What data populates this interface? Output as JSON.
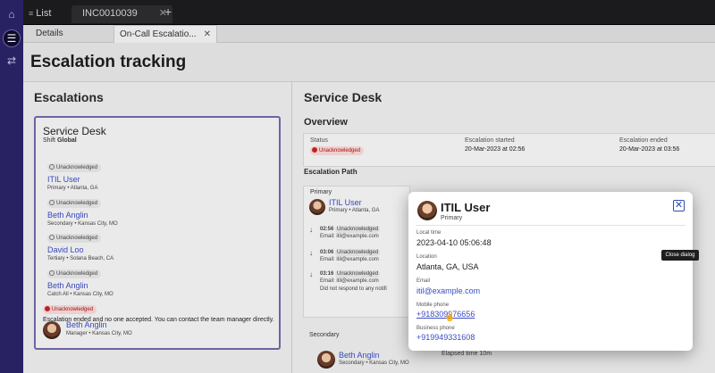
{
  "topbar": {
    "list_tab": "List",
    "incident_tab": "INC0010039"
  },
  "subtabs": {
    "details": "Details",
    "on_call": "On-Call Escalatio..."
  },
  "page": {
    "title": "Escalation tracking"
  },
  "escalations": {
    "heading": "Escalations",
    "card": {
      "title": "Service Desk",
      "shift_label": "Shift",
      "shift_value": "Global",
      "entries": [
        {
          "status": "Unacknowledged",
          "name": "ITIL User",
          "role": "Primary",
          "location": "Atlanta, GA"
        },
        {
          "status": "Unacknowledged",
          "name": "Beth Anglin",
          "role": "Secondary",
          "location": "Kansas City, MO"
        },
        {
          "status": "Unacknowledged",
          "name": "David Loo",
          "role": "Tertiary",
          "location": "Solana Beach, CA"
        },
        {
          "status": "Unacknowledged",
          "name": "Beth Anglin",
          "role": "Catch All",
          "location": "Kansas City, MO"
        }
      ],
      "final_status": "Unacknowledged",
      "ended_message": "Escalation ended and no one accepted. You can contact the team manager directly.",
      "manager": {
        "name": "Beth Anglin",
        "role": "Manager",
        "location": "Kansas City, MO"
      }
    }
  },
  "service_desk": {
    "heading": "Service Desk",
    "overview_heading": "Overview",
    "overview": {
      "status_label": "Status",
      "status_value": "Unacknowledged",
      "started_label": "Escalation started",
      "started_value": "20-Mar-2023 at 02:56",
      "ended_label": "Escalation ended",
      "ended_value": "20-Mar-2023 at 03:56"
    },
    "path_heading": "Escalation Path",
    "primary_label": "Primary",
    "primary_user": {
      "name": "ITIL User",
      "role": "Primary",
      "location": "Atlanta, GA"
    },
    "attempts": [
      {
        "time": "02:56",
        "status": "Unacknowledged",
        "detail": "Email: itil@example.com"
      },
      {
        "time": "03:06",
        "status": "Unacknowledged",
        "detail": "Email: itil@example.com"
      },
      {
        "time": "03:16",
        "status": "Unacknowledged",
        "detail": "Email: itil@example.com",
        "extra": "Did not respond to any notifi"
      }
    ],
    "secondary_label": "Secondary",
    "secondary_user": {
      "name": "Beth Anglin",
      "role": "Secondary",
      "location": "Kansas City, MO"
    },
    "elapsed": "Elapsed time 10m"
  },
  "dialog": {
    "name": "ITIL User",
    "role": "Primary",
    "local_time_label": "Local time",
    "local_time": "2023-04-10 05:06:48",
    "location_label": "Location",
    "location": "Atlanta, GA, USA",
    "email_label": "Email",
    "email": "itil@example.com",
    "mobile_label": "Mobile phone",
    "mobile": "+918309976656",
    "business_label": "Business phone",
    "business": "+919949331608",
    "close_tooltip": "Close dialog"
  },
  "colors": {
    "rail": "#2b2466",
    "link": "#3a4cc4",
    "danger": "#c22222"
  }
}
